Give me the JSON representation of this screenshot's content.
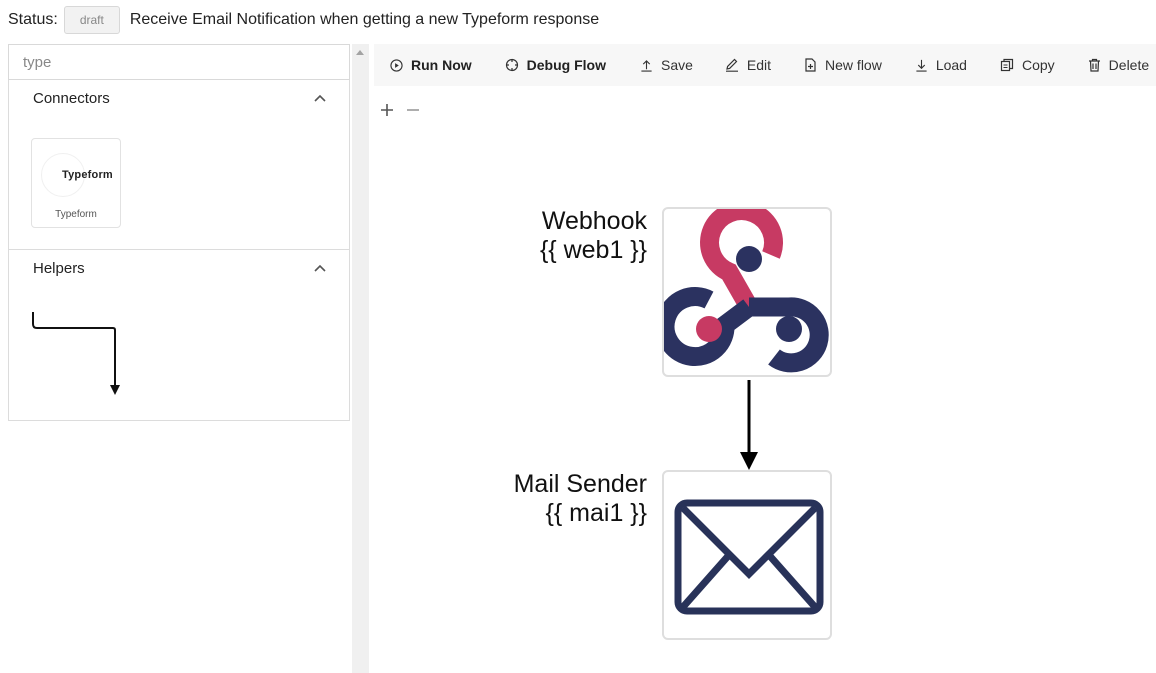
{
  "status": {
    "label": "Status:",
    "badge": "draft",
    "flow_title": "Receive Email Notification when getting a new Typeform response"
  },
  "sidebar": {
    "search_placeholder": "type",
    "sections": [
      {
        "title": "Connectors",
        "items": [
          {
            "logo_text": "Typeform",
            "caption": "Typeform"
          }
        ]
      },
      {
        "title": "Helpers"
      }
    ]
  },
  "toolbar": {
    "run_now": "Run Now",
    "debug_flow": "Debug Flow",
    "save": "Save",
    "edit": "Edit",
    "new_flow": "New flow",
    "load": "Load",
    "copy": "Copy",
    "delete": "Delete"
  },
  "canvas": {
    "nodes": [
      {
        "name": "Webhook",
        "ref": "{{ web1 }}",
        "icon": "webhook-icon"
      },
      {
        "name": "Mail Sender",
        "ref": "{{ mai1 }}",
        "icon": "mail-icon"
      }
    ]
  },
  "colors": {
    "webhook_pink": "#c73a63",
    "webhook_navy": "#2b3260",
    "mail_navy": "#283259",
    "toolbar_bg": "#f7f7f7"
  }
}
